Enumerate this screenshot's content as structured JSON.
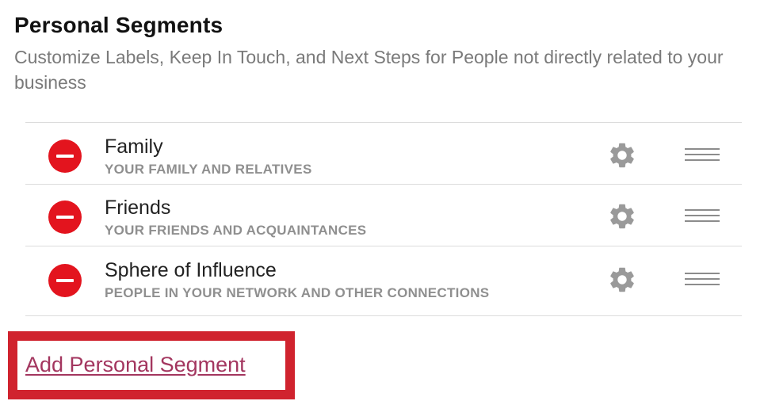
{
  "header": {
    "title": "Personal Segments",
    "subtitle": "Customize Labels, Keep In Touch, and Next Steps for People not directly related to your business"
  },
  "segments": [
    {
      "name": "Family",
      "description": "YOUR FAMILY AND RELATIVES",
      "remove_icon": "minus-circle-icon",
      "settings_icon": "gear-icon",
      "drag_icon": "drag-handle-icon"
    },
    {
      "name": "Friends",
      "description": "YOUR FRIENDS AND ACQUAINTANCES",
      "remove_icon": "minus-circle-icon",
      "settings_icon": "gear-icon",
      "drag_icon": "drag-handle-icon"
    },
    {
      "name": "Sphere of Influence",
      "description": "PEOPLE IN YOUR NETWORK AND OTHER CONNECTIONS",
      "remove_icon": "minus-circle-icon",
      "settings_icon": "gear-icon",
      "drag_icon": "drag-handle-icon"
    }
  ],
  "actions": {
    "add_segment_label": "Add Personal Segment"
  },
  "colors": {
    "remove_red": "#e3141e",
    "link": "#a3365f",
    "highlight_border": "#d0232e",
    "muted_text": "#8f8f8f",
    "icon_gray": "#9a9a9a"
  }
}
